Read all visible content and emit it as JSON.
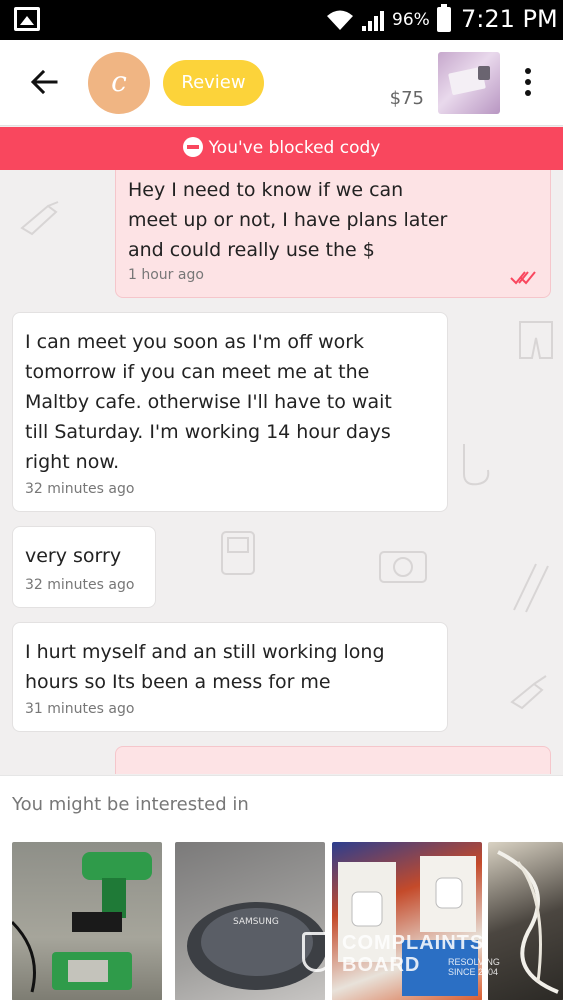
{
  "status_bar": {
    "battery_percent": "96%",
    "time": "7:21 PM",
    "icons": [
      "gallery-icon",
      "wifi-icon",
      "signal-icon",
      "battery-icon"
    ]
  },
  "header": {
    "avatar_initial": "c",
    "review_label": "Review",
    "price": "$75",
    "icons": [
      "back-arrow-icon",
      "more-vert-icon"
    ]
  },
  "banner": {
    "text": "You've blocked cody",
    "icon": "blocked-icon",
    "color": "#f9475e"
  },
  "messages": [
    {
      "direction": "outgoing",
      "lines": [
        "Hey I need to know if we can",
        "meet up or not, I have plans later",
        "and could really use the $"
      ],
      "time": "1 hour ago",
      "read_icon": "double-check-icon"
    },
    {
      "direction": "incoming",
      "lines": [
        "I can meet you soon as I'm off work",
        "tomorrow if you can meet me at the",
        "Maltby cafe. otherwise I'll have to wait",
        "till Saturday. I'm working 14 hour days",
        "right now."
      ],
      "time": "32 minutes ago"
    },
    {
      "direction": "incoming",
      "lines": [
        "very sorry"
      ],
      "time": "32 minutes ago"
    },
    {
      "direction": "incoming",
      "lines": [
        "I hurt myself and an still working long",
        "hours so Its been a mess for me"
      ],
      "time": "31 minutes ago"
    }
  ],
  "recommendations": {
    "title": "You might be interested in",
    "items": [
      {
        "name": "drill-thumbnail"
      },
      {
        "name": "samsung-charger-thumbnail",
        "label": "SAMSUNG"
      },
      {
        "name": "smart-plug-thumbnail"
      },
      {
        "name": "cable-thumbnail"
      }
    ]
  },
  "watermark": {
    "line1": "COMPLAINTS",
    "line2": "BOARD",
    "line3a": "RESOLVING",
    "line3b": "SINCE 2004"
  },
  "colors": {
    "accent_review": "#fcd33a",
    "avatar_bg": "#f0b583",
    "outgoing_bubble": "#fde3e5",
    "read_ticks": "#f9475e"
  }
}
